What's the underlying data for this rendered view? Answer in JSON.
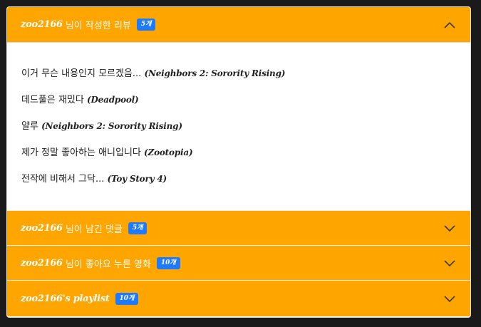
{
  "sections": [
    {
      "username": "zoo2166",
      "label": " 님이 작성한 리뷰",
      "count": "5개",
      "expanded": true,
      "reviews": [
        {
          "text": "이거 무슨 내용인지 모르겠음...",
          "movie": "(Neighbors 2: Sorority Rising)"
        },
        {
          "text": "데드풀은 재밌다",
          "movie": "(Deadpool)"
        },
        {
          "text": "얄루",
          "movie": "(Neighbors 2: Sorority Rising)"
        },
        {
          "text": "제가 정말 좋아하는 애니입니다",
          "movie": "(Zootopia)"
        },
        {
          "text": "전작에 비해서 그닥...",
          "movie": "(Toy Story 4)"
        }
      ]
    },
    {
      "username": "zoo2166",
      "label": " 님이 남긴 댓글",
      "count": "5개",
      "expanded": false
    },
    {
      "username": "zoo2166",
      "label": " 님이 좋아요 누른 영화",
      "count": "10개",
      "expanded": false
    },
    {
      "username": "zoo2166's playlist",
      "label": "",
      "count": "10개",
      "expanded": false
    }
  ],
  "icons": {
    "collapse": "chevron-up-icon",
    "expand": "chevron-down-icon"
  },
  "colors": {
    "header_bg": "#ffa500",
    "badge_bg": "#1e7bff",
    "page_bg": "#1a1a1a"
  }
}
